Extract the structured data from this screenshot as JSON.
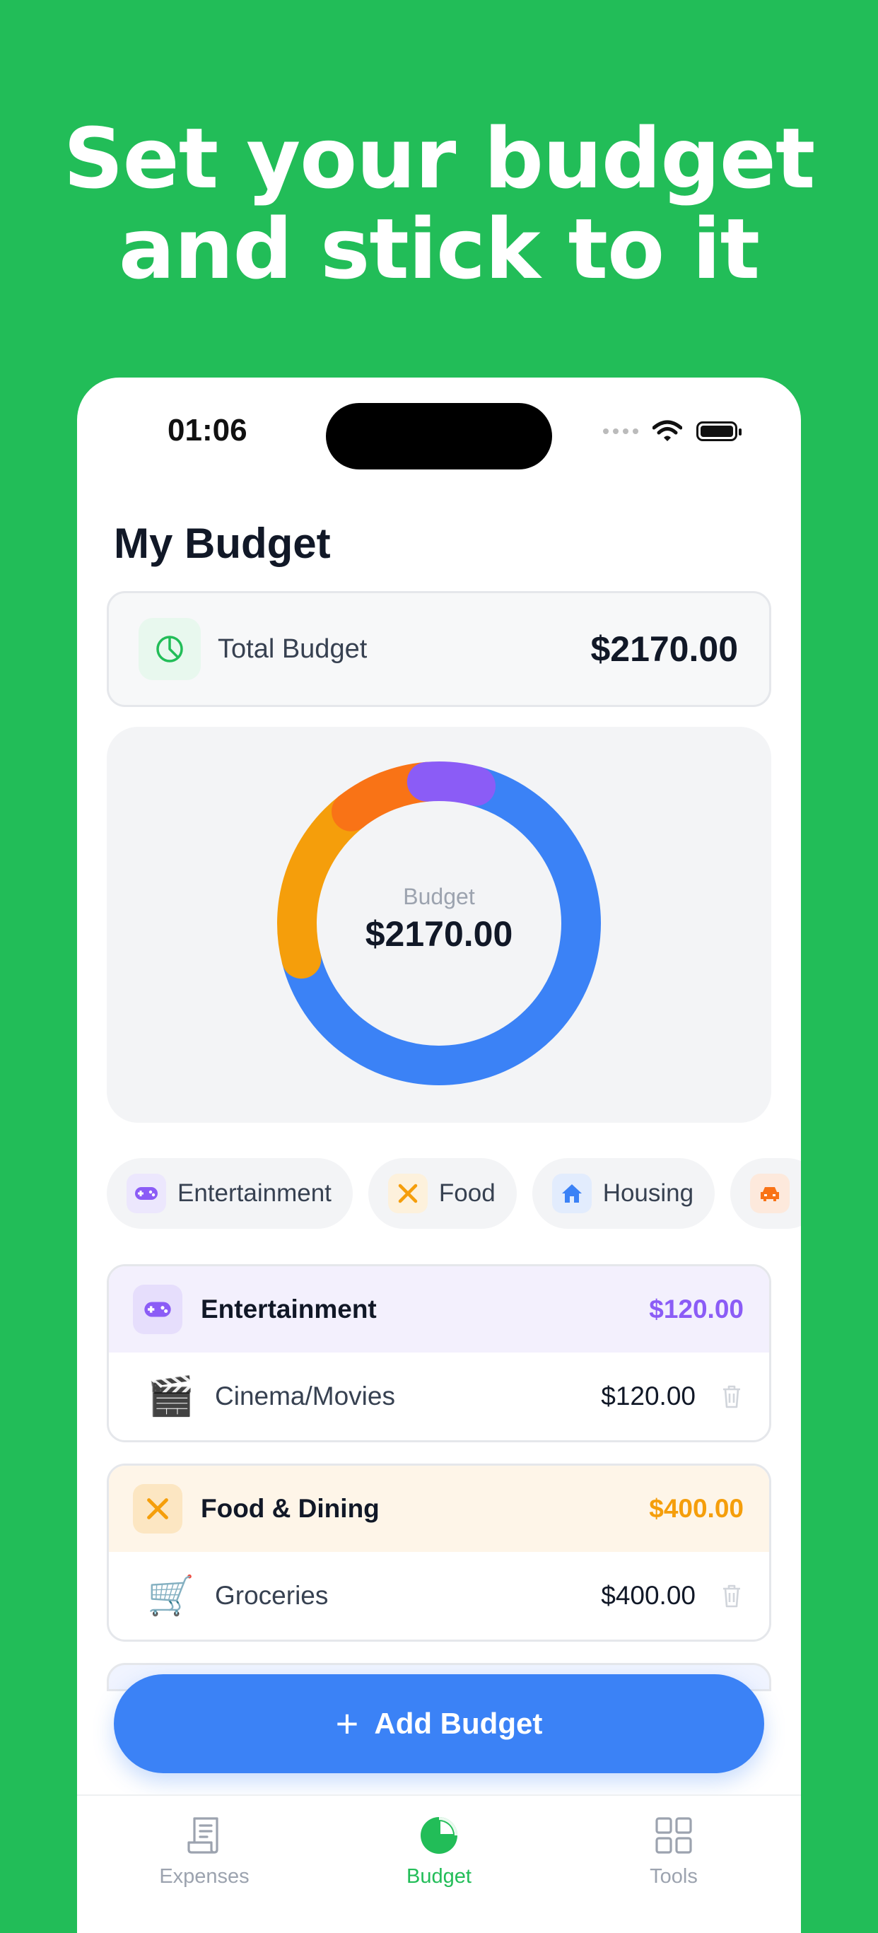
{
  "headline": {
    "line1": "Set your budget",
    "line2": "and stick to it"
  },
  "status_bar": {
    "time": "01:06"
  },
  "page_title": "My Budget",
  "total_budget": {
    "label": "Total Budget",
    "value": "$2170.00",
    "icon": "pie-chart-icon"
  },
  "chart_data": {
    "type": "pie",
    "center_label": "Budget",
    "center_value": "$2170.00",
    "series": [
      {
        "name": "Housing",
        "value": 1450,
        "color": "#3B82F6"
      },
      {
        "name": "Food",
        "value": 400,
        "color": "#F59E0B"
      },
      {
        "name": "Transport",
        "value": 200,
        "color": "#F97316"
      },
      {
        "name": "Entertainment",
        "value": 120,
        "color": "#8B5CF6"
      }
    ]
  },
  "chips": [
    {
      "label": "Entertainment",
      "icon": "gamepad-icon",
      "color": "#8B5CF6",
      "bg": "#ECE7FD"
    },
    {
      "label": "Food",
      "icon": "utensils-icon",
      "color": "#F59E0B",
      "bg": "#FDF1DC"
    },
    {
      "label": "Housing",
      "icon": "house-icon",
      "color": "#3B82F6",
      "bg": "#E2ECFD"
    },
    {
      "label": "",
      "icon": "car-icon",
      "color": "#F97316",
      "bg": "#FDE9DC"
    }
  ],
  "groups": [
    {
      "title": "Entertainment",
      "total": "$120.00",
      "icon": "gamepad-icon",
      "color": "#8B5CF6",
      "head_bg": "#F3F0FD",
      "items": [
        {
          "emoji": "🎬",
          "label": "Cinema/Movies",
          "value": "$120.00"
        }
      ]
    },
    {
      "title": "Food & Dining",
      "total": "$400.00",
      "icon": "utensils-icon",
      "color": "#F59E0B",
      "head_bg": "#FEF5E8",
      "items": [
        {
          "emoji": "🛒",
          "label": "Groceries",
          "value": "$400.00"
        }
      ]
    }
  ],
  "add_button": {
    "label": "Add Budget"
  },
  "tabs": [
    {
      "label": "Expenses",
      "icon": "receipt-icon",
      "active": false
    },
    {
      "label": "Budget",
      "icon": "pie-chart-icon",
      "active": true
    },
    {
      "label": "Tools",
      "icon": "grid-icon",
      "active": false
    }
  ],
  "colors": {
    "brand": "#22BD58",
    "accent": "#3B82F6",
    "tab_inactive": "#9CA3AF",
    "tab_active": "#22BD58"
  }
}
